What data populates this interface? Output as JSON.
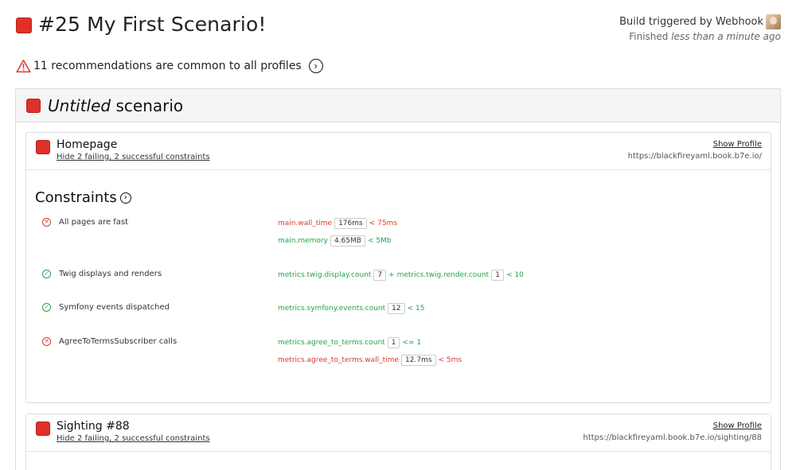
{
  "header": {
    "title": "#25 My First Scenario!",
    "build_triggered": "Build triggered by Webhook",
    "finished_label": "Finished",
    "finished_time": "less than a minute ago"
  },
  "recommendations": {
    "text": "11 recommendations are common to all profiles"
  },
  "scenario": {
    "title_italic": "Untitled",
    "title_rest": "scenario"
  },
  "profiles": [
    {
      "name": "Homepage",
      "toggle": "Hide 2 failing, 2 successful constraints",
      "show_profile": "Show Profile",
      "url": "https://blackfireyaml.book.b7e.io/",
      "constraints_title": "Constraints",
      "constraints": [
        {
          "label": "All pages are fast",
          "status": "fail",
          "assertions": [
            {
              "metric": "main.wall_time",
              "value": "176ms",
              "threshold": "< 75ms",
              "status": "fail"
            },
            {
              "metric": "main.memory",
              "value": "4.65MB",
              "threshold": "< 5Mb",
              "status": "ok"
            }
          ]
        },
        {
          "label": "Twig displays and renders",
          "status": "ok",
          "assertions": [
            {
              "metric": "metrics.twig.display.count",
              "value": "7",
              "op": "+",
              "metric2": "metrics.twig.render.count",
              "value2": "1",
              "threshold": "< 10",
              "status": "ok"
            }
          ]
        },
        {
          "label": "Symfony events dispatched",
          "status": "ok",
          "assertions": [
            {
              "metric": "metrics.symfony.events.count",
              "value": "12",
              "threshold": "< 15",
              "status": "ok"
            }
          ]
        },
        {
          "label": "AgreeToTermsSubscriber calls",
          "status": "fail",
          "assertions": [
            {
              "metric": "metrics.agree_to_terms.count",
              "value": "1",
              "threshold": "<= 1",
              "status": "ok"
            },
            {
              "metric": "metrics.agree_to_terms.wall_time",
              "value": "12.7ms",
              "threshold": "< 5ms",
              "status": "fail"
            }
          ]
        }
      ]
    },
    {
      "name": "Sighting #88",
      "toggle": "Hide 2 failing, 2 successful constraints",
      "show_profile": "Show Profile",
      "url": "https://blackfireyaml.book.b7e.io/sighting/88"
    }
  ],
  "colors": {
    "fail": "#d93a2b",
    "ok": "#27a14a",
    "status_square": "#e0302a"
  },
  "icons": {
    "status": "red-square-icon",
    "warning": "warning-triangle-icon",
    "arrow": "chevron-right-circle-icon",
    "fail": "x-circle-icon",
    "ok": "check-circle-icon"
  }
}
